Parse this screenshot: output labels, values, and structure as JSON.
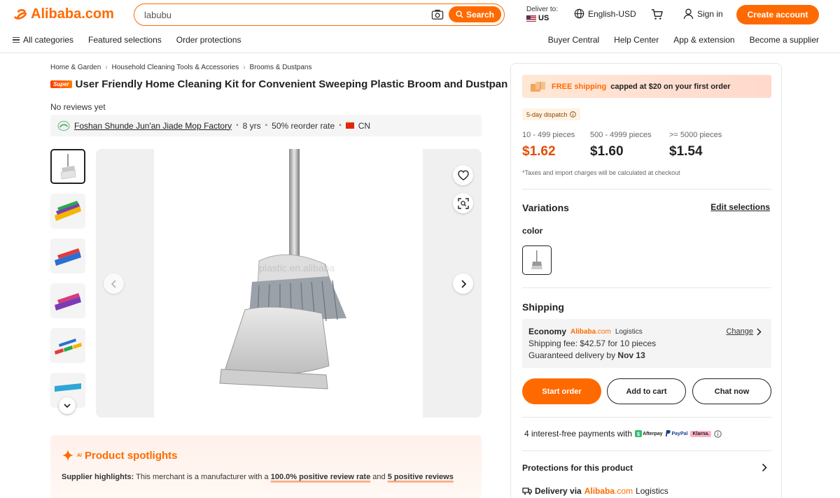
{
  "header": {
    "logo_text": "Alibaba.com",
    "search_value": "labubu",
    "search_button": "Search",
    "deliver_to_label": "Deliver to:",
    "deliver_country": "US",
    "language": "English-USD",
    "sign_in": "Sign in",
    "create_account": "Create account"
  },
  "nav": {
    "left": [
      "All categories",
      "Featured selections",
      "Order protections"
    ],
    "right": [
      "Buyer Central",
      "Help Center",
      "App & extension",
      "Become a supplier"
    ]
  },
  "breadcrumb": [
    "Home & Garden",
    "Household Cleaning Tools & Accessories",
    "Brooms & Dustpans"
  ],
  "product": {
    "badge": "Super",
    "title": "User Friendly Home Cleaning Kit for Convenient Sweeping Plastic Broom and Dustpan",
    "reviews": "No reviews yet",
    "watermark": "plastic.en.alibaba"
  },
  "supplier": {
    "name": "Foshan Shunde Jun'an Jiade Mop Factory",
    "years": "8 yrs",
    "reorder": "50% reorder rate",
    "country": "CN"
  },
  "spotlight": {
    "ai_tag": "AI",
    "title": "Product spotlights",
    "label": "Supplier highlights:",
    "text_before": "This merchant is a manufacturer with a",
    "highlight1": "100.0% positive review rate",
    "text_mid": "and",
    "highlight2": "5 positive reviews"
  },
  "panel": {
    "promo_free": "FREE shipping",
    "promo_rest": "capped at $20 on your first order",
    "dispatch": "5-day dispatch",
    "tiers": [
      {
        "range": "10 - 499 pieces",
        "price": "$1.62"
      },
      {
        "range": "500 - 4999 pieces",
        "price": "$1.60"
      },
      {
        "range": ">= 5000 pieces",
        "price": "$1.54"
      }
    ],
    "taxes": "*Taxes and import charges will be calculated at checkout",
    "variations_title": "Variations",
    "edit_selections": "Edit selections",
    "color_label": "color",
    "shipping_title": "Shipping",
    "economy": "Economy",
    "ali_name": "Alibaba",
    "ali_com": ".com",
    "logistics": "Logistics",
    "change": "Change",
    "shipping_fee": "Shipping fee: $42.57 for 10 pieces",
    "guaranteed_prefix": "Guaranteed delivery by",
    "guaranteed_date": "Nov 13",
    "start_order": "Start order",
    "add_to_cart": "Add to cart",
    "chat_now": "Chat now",
    "installments": "4 interest-free payments with",
    "afterpay": "Afterpay",
    "paypal": "PayPal",
    "klarna": "Klarna.",
    "protections": "Protections for this product",
    "delivery_via": "Delivery via"
  },
  "colors": {
    "accent": "#ff6a00",
    "price_highlight": "#e64d00"
  }
}
